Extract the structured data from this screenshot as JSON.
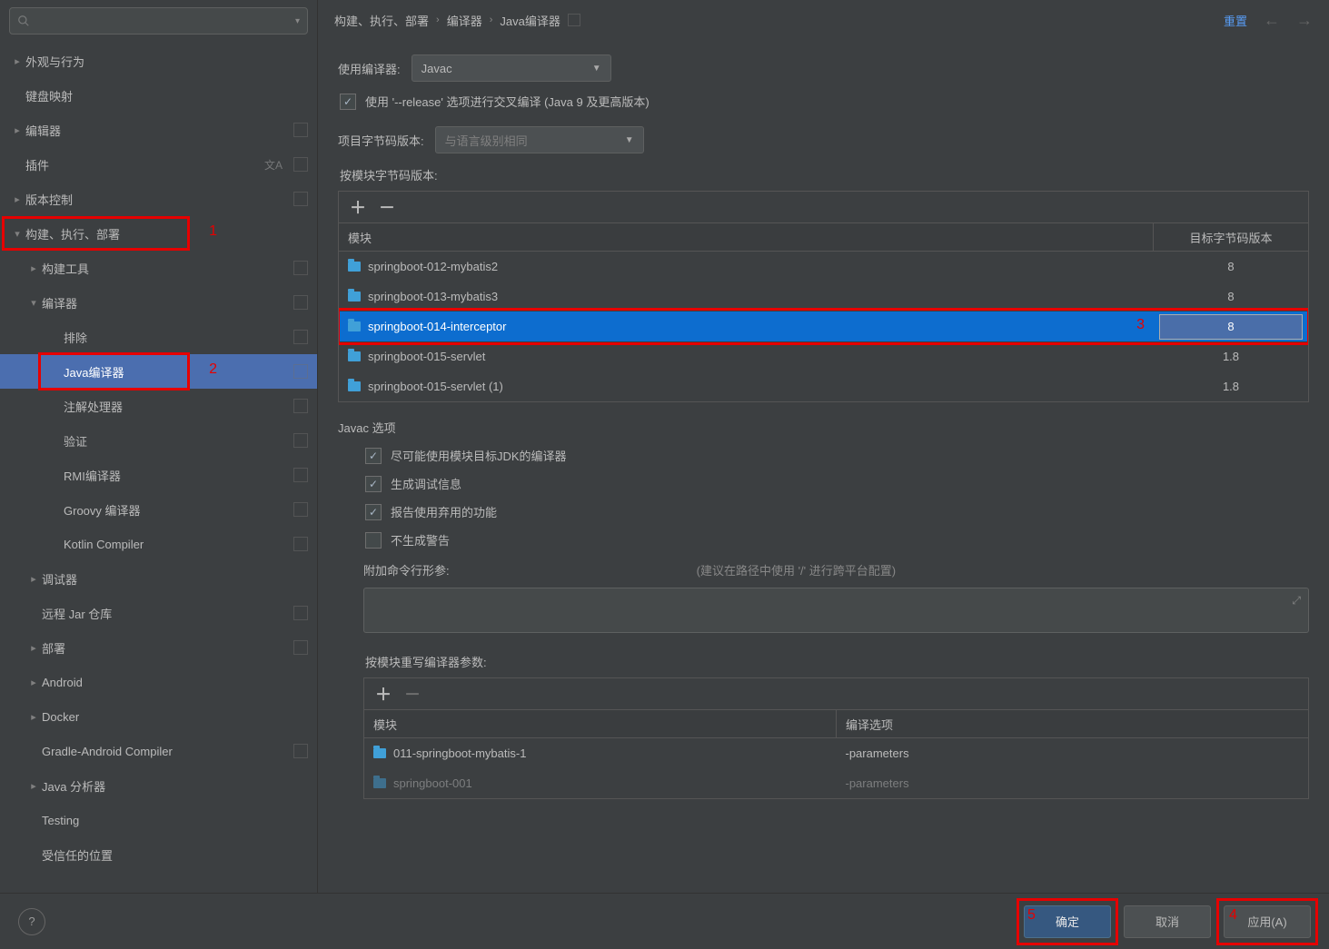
{
  "sidebar": {
    "search_placeholder": "",
    "items": [
      {
        "label": "外观与行为",
        "level": 0,
        "arrow": ">",
        "icons": []
      },
      {
        "label": "键盘映射",
        "level": 0,
        "arrow": "none",
        "icons": []
      },
      {
        "label": "编辑器",
        "level": 0,
        "arrow": ">",
        "icons": [
          "sq"
        ]
      },
      {
        "label": "插件",
        "level": 0,
        "arrow": "none",
        "icons": [
          "lang",
          "sq"
        ]
      },
      {
        "label": "版本控制",
        "level": 0,
        "arrow": ">",
        "icons": [
          "sq"
        ]
      },
      {
        "label": "构建、执行、部署",
        "level": 0,
        "arrow": "v",
        "icons": [],
        "hl": 1,
        "hl_num": "1"
      },
      {
        "label": "构建工具",
        "level": 1,
        "arrow": ">",
        "icons": [
          "sq"
        ]
      },
      {
        "label": "编译器",
        "level": 1,
        "arrow": "v",
        "icons": [
          "sq"
        ]
      },
      {
        "label": "排除",
        "level": 2,
        "arrow": "none",
        "icons": [
          "sq"
        ]
      },
      {
        "label": "Java编译器",
        "level": 2,
        "arrow": "none",
        "icons": [
          "sq"
        ],
        "selected": true,
        "hl": 2,
        "hl_num": "2"
      },
      {
        "label": "注解处理器",
        "level": 2,
        "arrow": "none",
        "icons": [
          "sq"
        ]
      },
      {
        "label": "验证",
        "level": 2,
        "arrow": "none",
        "icons": [
          "sq"
        ]
      },
      {
        "label": "RMI编译器",
        "level": 2,
        "arrow": "none",
        "icons": [
          "sq"
        ]
      },
      {
        "label": "Groovy 编译器",
        "level": 2,
        "arrow": "none",
        "icons": [
          "sq"
        ]
      },
      {
        "label": "Kotlin Compiler",
        "level": 2,
        "arrow": "none",
        "icons": [
          "sq"
        ]
      },
      {
        "label": "调试器",
        "level": 1,
        "arrow": ">",
        "icons": []
      },
      {
        "label": "远程 Jar 仓库",
        "level": 1,
        "arrow": "none",
        "icons": [
          "sq"
        ]
      },
      {
        "label": "部署",
        "level": 1,
        "arrow": ">",
        "icons": [
          "sq"
        ]
      },
      {
        "label": "Android",
        "level": 1,
        "arrow": ">",
        "icons": []
      },
      {
        "label": "Docker",
        "level": 1,
        "arrow": ">",
        "icons": []
      },
      {
        "label": "Gradle-Android Compiler",
        "level": 1,
        "arrow": "none",
        "icons": [
          "sq"
        ]
      },
      {
        "label": "Java 分析器",
        "level": 1,
        "arrow": ">",
        "icons": []
      },
      {
        "label": "Testing",
        "level": 1,
        "arrow": "none",
        "icons": []
      },
      {
        "label": "受信任的位置",
        "level": 1,
        "arrow": "none",
        "icons": []
      }
    ]
  },
  "breadcrumb": {
    "parts": [
      "构建、执行、部署",
      "编译器",
      "Java编译器"
    ],
    "reset": "重置"
  },
  "form": {
    "compiler_label": "使用编译器:",
    "compiler_value": "Javac",
    "release_checkbox": "使用 '--release' 选项进行交叉编译 (Java 9 及更高版本)",
    "project_bytecode_label": "项目字节码版本:",
    "project_bytecode_placeholder": "与语言级别相同",
    "module_bytecode_label": "按模块字节码版本:",
    "module_table": {
      "header_module": "模块",
      "header_version": "目标字节码版本",
      "rows": [
        {
          "module": "springboot-012-mybatis2",
          "version": "8"
        },
        {
          "module": "springboot-013-mybatis3",
          "version": "8"
        },
        {
          "module": "springboot-014-interceptor",
          "version": "8",
          "selected": true,
          "hl_num": "3"
        },
        {
          "module": "springboot-015-servlet",
          "version": "1.8"
        },
        {
          "module": "springboot-015-servlet (1)",
          "version": "1.8"
        }
      ]
    },
    "javac_options_title": "Javac 选项",
    "javac_opts": [
      {
        "label": "尽可能使用模块目标JDK的编译器",
        "checked": true
      },
      {
        "label": "生成调试信息",
        "checked": true
      },
      {
        "label": "报告使用弃用的功能",
        "checked": true
      },
      {
        "label": "不生成警告",
        "checked": false
      }
    ],
    "additional_cmd_label": "附加命令行形参:",
    "additional_cmd_hint": "(建议在路径中使用 '/' 进行跨平台配置)",
    "override_params_label": "按模块重写编译器参数:",
    "override_table": {
      "header_module": "模块",
      "header_opts": "编译选项",
      "rows": [
        {
          "module": "011-springboot-mybatis-1",
          "opts": "-parameters"
        },
        {
          "module": "springboot-001",
          "opts": "-parameters"
        }
      ]
    }
  },
  "footer": {
    "ok": "确定",
    "cancel": "取消",
    "apply": "应用(A)",
    "ok_num": "5",
    "apply_num": "4"
  }
}
